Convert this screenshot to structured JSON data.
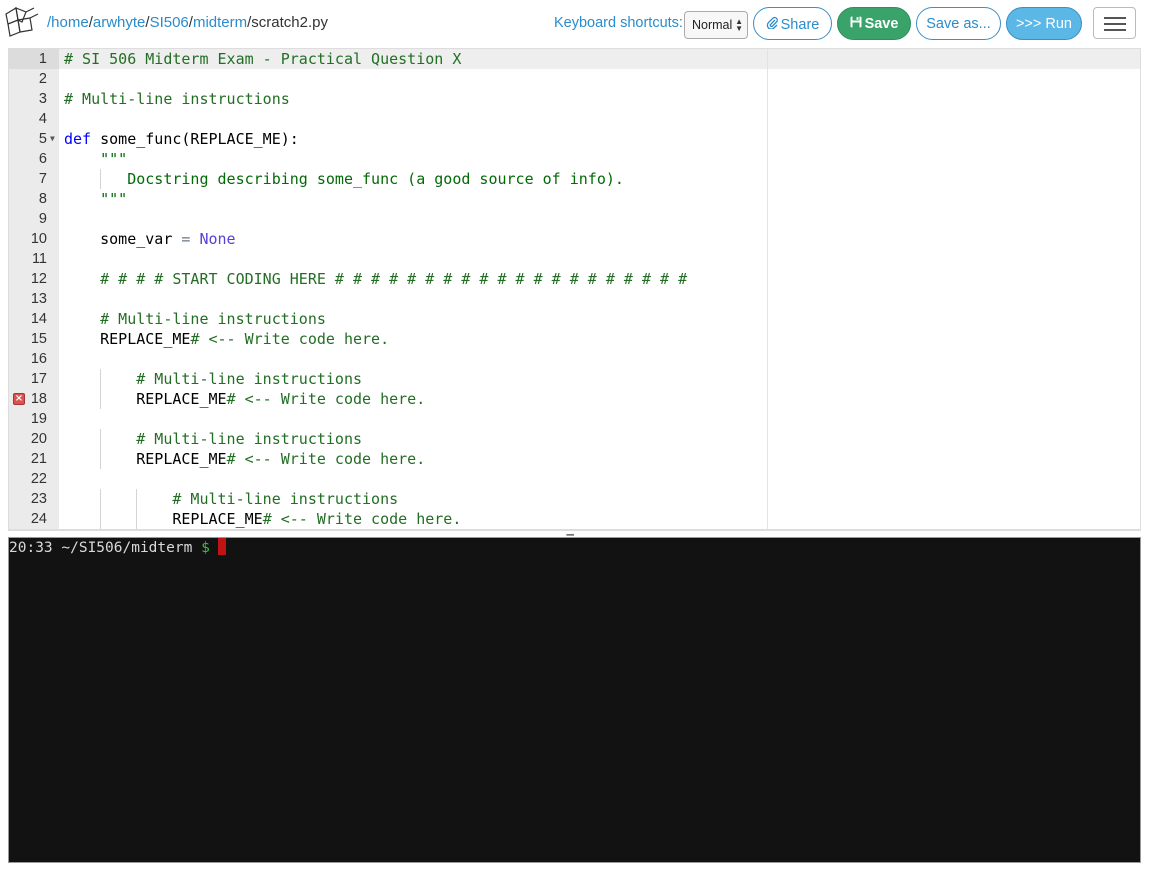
{
  "header": {
    "path_segments": [
      "/home",
      "arwhyte",
      "SI506",
      "midterm"
    ],
    "filename": "scratch2.py",
    "keyboard_label": "Keyboard shortcuts:",
    "keyboard_mode": "Normal",
    "share_label": "Share",
    "save_label": "Save",
    "save_as_label": "Save as...",
    "run_label": ">>> Run"
  },
  "editor": {
    "lines": [
      {
        "n": "1",
        "tokens": [
          {
            "c": "comment",
            "t": "# SI 506 Midterm Exam - Practical Question X"
          }
        ]
      },
      {
        "n": "2",
        "tokens": []
      },
      {
        "n": "3",
        "tokens": [
          {
            "c": "comment",
            "t": "# Multi-line instructions"
          }
        ]
      },
      {
        "n": "4",
        "tokens": []
      },
      {
        "n": "5",
        "fold": true,
        "tokens": [
          {
            "c": "kw",
            "t": "def"
          },
          {
            "c": "plain",
            "t": " some_func(REPLACE_ME):"
          }
        ]
      },
      {
        "n": "6",
        "tokens": [
          {
            "c": "str",
            "t": "    \"\"\""
          }
        ]
      },
      {
        "n": "7",
        "tokens": [
          {
            "c": "str",
            "t": "       Docstring describing some_func (a good source of info)."
          }
        ]
      },
      {
        "n": "8",
        "tokens": [
          {
            "c": "str",
            "t": "    \"\"\""
          }
        ]
      },
      {
        "n": "9",
        "tokens": []
      },
      {
        "n": "10",
        "tokens": [
          {
            "c": "plain",
            "t": "    some_var "
          },
          {
            "c": "op",
            "t": "="
          },
          {
            "c": "plain",
            "t": " "
          },
          {
            "c": "const",
            "t": "None"
          }
        ]
      },
      {
        "n": "11",
        "tokens": []
      },
      {
        "n": "12",
        "tokens": [
          {
            "c": "comment",
            "t": "    # # # # START CODING HERE # # # # # # # # # # # # # # # # # # # #"
          }
        ]
      },
      {
        "n": "13",
        "tokens": []
      },
      {
        "n": "14",
        "tokens": [
          {
            "c": "comment",
            "t": "    # Multi-line instructions"
          }
        ]
      },
      {
        "n": "15",
        "tokens": [
          {
            "c": "plain",
            "t": "    REPLACE_ME"
          },
          {
            "c": "comment",
            "t": "# <-- Write code here."
          }
        ]
      },
      {
        "n": "16",
        "tokens": []
      },
      {
        "n": "17",
        "tokens": [
          {
            "c": "comment",
            "t": "        # Multi-line instructions"
          }
        ]
      },
      {
        "n": "18",
        "error": true,
        "tokens": [
          {
            "c": "plain",
            "t": "        REPLACE_ME"
          },
          {
            "c": "comment",
            "t": "# <-- Write code here."
          }
        ]
      },
      {
        "n": "19",
        "tokens": []
      },
      {
        "n": "20",
        "tokens": [
          {
            "c": "comment",
            "t": "        # Multi-line instructions"
          }
        ]
      },
      {
        "n": "21",
        "tokens": [
          {
            "c": "plain",
            "t": "        REPLACE_ME"
          },
          {
            "c": "comment",
            "t": "# <-- Write code here."
          }
        ]
      },
      {
        "n": "22",
        "tokens": []
      },
      {
        "n": "23",
        "tokens": [
          {
            "c": "comment",
            "t": "            # Multi-line instructions"
          }
        ]
      },
      {
        "n": "24",
        "tokens": [
          {
            "c": "plain",
            "t": "            REPLACE_ME"
          },
          {
            "c": "comment",
            "t": "# <-- Write code here."
          }
        ]
      }
    ]
  },
  "terminal": {
    "prompt_text": "20:33 ~/SI506/midterm ",
    "prompt_symbol": "$"
  },
  "colors": {
    "accent": "#2a8ccc",
    "save_green": "#3aa36a",
    "run_blue": "#5bb7e6",
    "terminal_bg": "#121212",
    "comment_green": "#236e24"
  },
  "icons": {
    "logo": "pythonanywhere-logo-icon",
    "share": "paperclip-icon",
    "save": "floppy-disk-icon",
    "menu": "hamburger-menu-icon",
    "error": "error-marker-icon",
    "fold": "fold-arrow-icon"
  }
}
